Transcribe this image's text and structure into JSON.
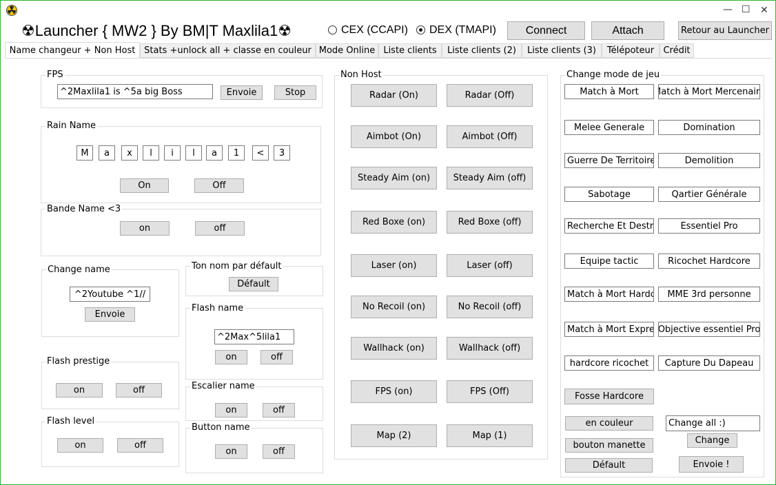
{
  "window": {
    "title": "☢Launcher { MW2 }  By BM|T Maxlila1☢",
    "minimize": "—",
    "maximize": "☐",
    "close": "✕",
    "icon": "radiation-icon"
  },
  "header": {
    "radio_cex": "CEX (CCAPI)",
    "radio_dex": "DEX (TMAPI)",
    "selected": "dex",
    "connect": "Connect",
    "attach": "Attach",
    "retour": "Retour au Launcher"
  },
  "tabs": [
    "Name changeur + Non Host",
    "Stats +unlock all + classe en couleur",
    "Mode Online",
    "Liste clients",
    "Liste clients (2)",
    "Liste clients (3)",
    "Télépoteur",
    "Crédit"
  ],
  "fps": {
    "label": "FPS",
    "input": "^2Maxlila1 is ^5a big Boss",
    "envoie": "Envoie",
    "stop": "Stop"
  },
  "rain": {
    "label": "Rain Name",
    "letters": [
      "M",
      "a",
      "x",
      "l",
      "i",
      "l",
      "a",
      "1",
      "<",
      "3"
    ],
    "on": "On",
    "off": "Off"
  },
  "bande": {
    "label": "Bande Name <3",
    "on": "on",
    "off": "off"
  },
  "change_name": {
    "label": "Change name",
    "input": "^2Youtube ^1//",
    "envoie": "Envoie"
  },
  "defaut_name": {
    "label": "Ton nom par défault",
    "button": "Défault"
  },
  "flash_name": {
    "label": "Flash name",
    "input": "^2Max^5lila1",
    "on": "on",
    "off": "off"
  },
  "flash_prestige": {
    "label": "Flash prestige",
    "on": "on",
    "off": "off"
  },
  "escalier": {
    "label": "Escalier name",
    "on": "on",
    "off": "off"
  },
  "flash_level": {
    "label": "Flash level",
    "on": "on",
    "off": "off"
  },
  "button_name": {
    "label": "Button name",
    "on": "on",
    "off": "off"
  },
  "non_host": {
    "label": "Non Host",
    "rows": [
      [
        "Radar (On)",
        "Radar (Off)"
      ],
      [
        "Aimbot (On)",
        "Aimbot (Off)"
      ],
      [
        "Steady Aim (on)",
        "Steady Aim (off)"
      ],
      [
        "Red Boxe (on)",
        "Red Boxe (off)"
      ],
      [
        "Laser (on)",
        "Laser (off)"
      ],
      [
        "No Recoil (on)",
        "No Recoil (off)"
      ],
      [
        "Wallhack (on)",
        "Wallhack (off)"
      ],
      [
        "FPS (on)",
        "FPS (Off)"
      ],
      [
        "Map (2)",
        "Map (1)"
      ]
    ]
  },
  "mode_jeu": {
    "label": "Change mode de jeu",
    "rows": [
      [
        "Match à Mort",
        "Match à Mort Mercenaire"
      ],
      [
        "Melee Generale",
        "Domination"
      ],
      [
        "Guerre De Territoire",
        "Demolition"
      ],
      [
        "Sabotage",
        "Qartier Générale"
      ],
      [
        "Recherche Et Destruction",
        "Essentiel Pro"
      ],
      [
        "Equipe tactic",
        "Ricochet Hardcore"
      ],
      [
        "Match à Mort Hardcore",
        "MME 3rd personne"
      ],
      [
        "Match à Mort Express",
        "Objective essentiel Pro"
      ],
      [
        "hardcore ricochet",
        "Capture Du Dapeau"
      ]
    ],
    "fosse": "Fosse Hardcore",
    "en_couleur": "en couleur",
    "bouton_manette": "bouton manette",
    "defaut": "Défault",
    "change_all_input": "Change all :)",
    "change": "Change",
    "envoie": "Envoie !"
  }
}
